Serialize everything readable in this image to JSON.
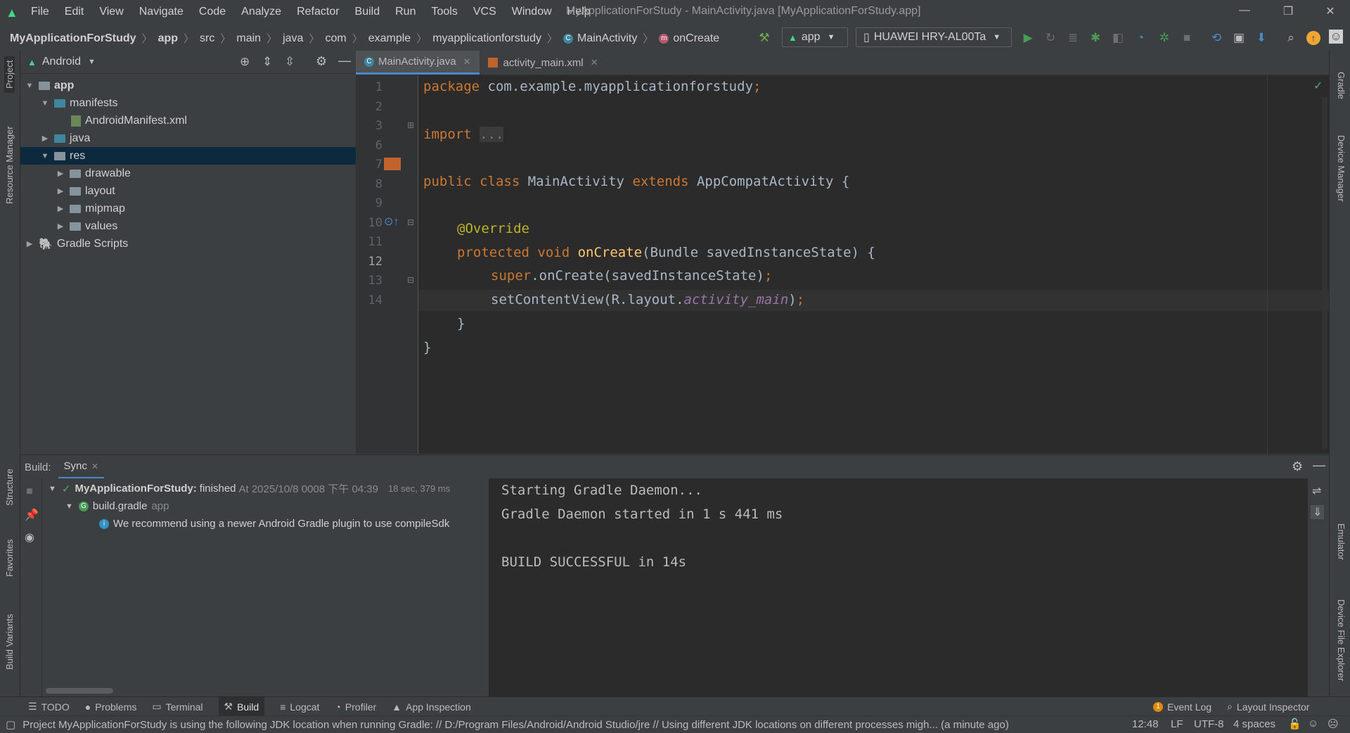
{
  "menu": [
    "File",
    "Edit",
    "View",
    "Navigate",
    "Code",
    "Analyze",
    "Refactor",
    "Build",
    "Run",
    "Tools",
    "VCS",
    "Window",
    "Help"
  ],
  "window_title": "MyApplicationForStudy - MainActivity.java [MyApplicationForStudy.app]",
  "breadcrumb": [
    "MyApplicationForStudy",
    "app",
    "src",
    "main",
    "java",
    "com",
    "example",
    "myapplicationforstudy",
    "MainActivity",
    "onCreate"
  ],
  "run_config": "app",
  "device": "HUAWEI HRY-AL00Ta",
  "project_view": "Android",
  "tree": {
    "app": "app",
    "manifests": "manifests",
    "manifest_file": "AndroidManifest.xml",
    "java": "java",
    "res": "res",
    "drawable": "drawable",
    "layout": "layout",
    "mipmap": "mipmap",
    "values": "values",
    "gradle_scripts": "Gradle Scripts"
  },
  "editor_tabs": [
    "MainActivity.java",
    "activity_main.xml"
  ],
  "code": {
    "line_numbers": [
      "1",
      "2",
      "3",
      "6",
      "7",
      "8",
      "9",
      "10",
      "11",
      "12",
      "13",
      "14"
    ],
    "l1_kw": "package",
    "l1_rest": " com.example.myapplicationforstudy",
    "l1_semi": ";",
    "l3_kw": "import",
    "l3_fold": "...",
    "l7_kw1": "public class",
    "l7_name": " MainActivity ",
    "l7_kw2": "extends",
    "l7_rest": " AppCompatActivity {",
    "l9_ann": "@Override",
    "l10_kw": "protected void",
    "l10_fn": "onCreate",
    "l10_rest": "(Bundle savedInstanceState) {",
    "l11_kw": "super",
    "l11_rest": ".onCreate(savedInstanceState)",
    "l11_semi": ";",
    "l12_a": "setContentView(R.layout.",
    "l12_it": "activity_main",
    "l12_b": ")",
    "l12_semi": ";",
    "l13": "}",
    "l14": "}"
  },
  "build": {
    "label": "Build:",
    "tab": "Sync",
    "root_name": "MyApplicationForStudy:",
    "root_status": "finished",
    "root_time": "At 2025/10/8  0008 下午 04:39",
    "root_duration": "18 sec, 379 ms",
    "child": "build.gradle",
    "child_module": "app",
    "info": "We recommend using a newer Android Gradle plugin to use compileSdk",
    "output": [
      "Starting Gradle Daemon...",
      "Gradle Daemon started in 1 s 441 ms",
      "",
      "BUILD SUCCESSFUL in 14s"
    ]
  },
  "bottom_tabs": [
    "TODO",
    "Problems",
    "Terminal",
    "Build",
    "Logcat",
    "Profiler",
    "App Inspection"
  ],
  "bottom_right": [
    "Event Log",
    "Layout Inspector"
  ],
  "event_count": "1",
  "status": {
    "message": "Project MyApplicationForStudy is using the following JDK location when running Gradle: // D:/Program Files/Android/Android Studio/jre // Using different JDK locations on different processes migh... (a minute ago)",
    "position": "12:48",
    "line_sep": "LF",
    "encoding": "UTF-8",
    "indent": "4 spaces"
  },
  "left_tool_tabs": [
    "Project",
    "Resource Manager",
    "Structure",
    "Favorites",
    "Build Variants"
  ],
  "right_tool_tabs": [
    "Gradle",
    "Device Manager",
    "Emulator",
    "Device File Explorer"
  ],
  "colors": {
    "keyword": "#cc7832",
    "annotation": "#bbb529",
    "function": "#ffc66d",
    "field": "#9876aa",
    "selection": "#0d293e",
    "success": "#59a869"
  }
}
